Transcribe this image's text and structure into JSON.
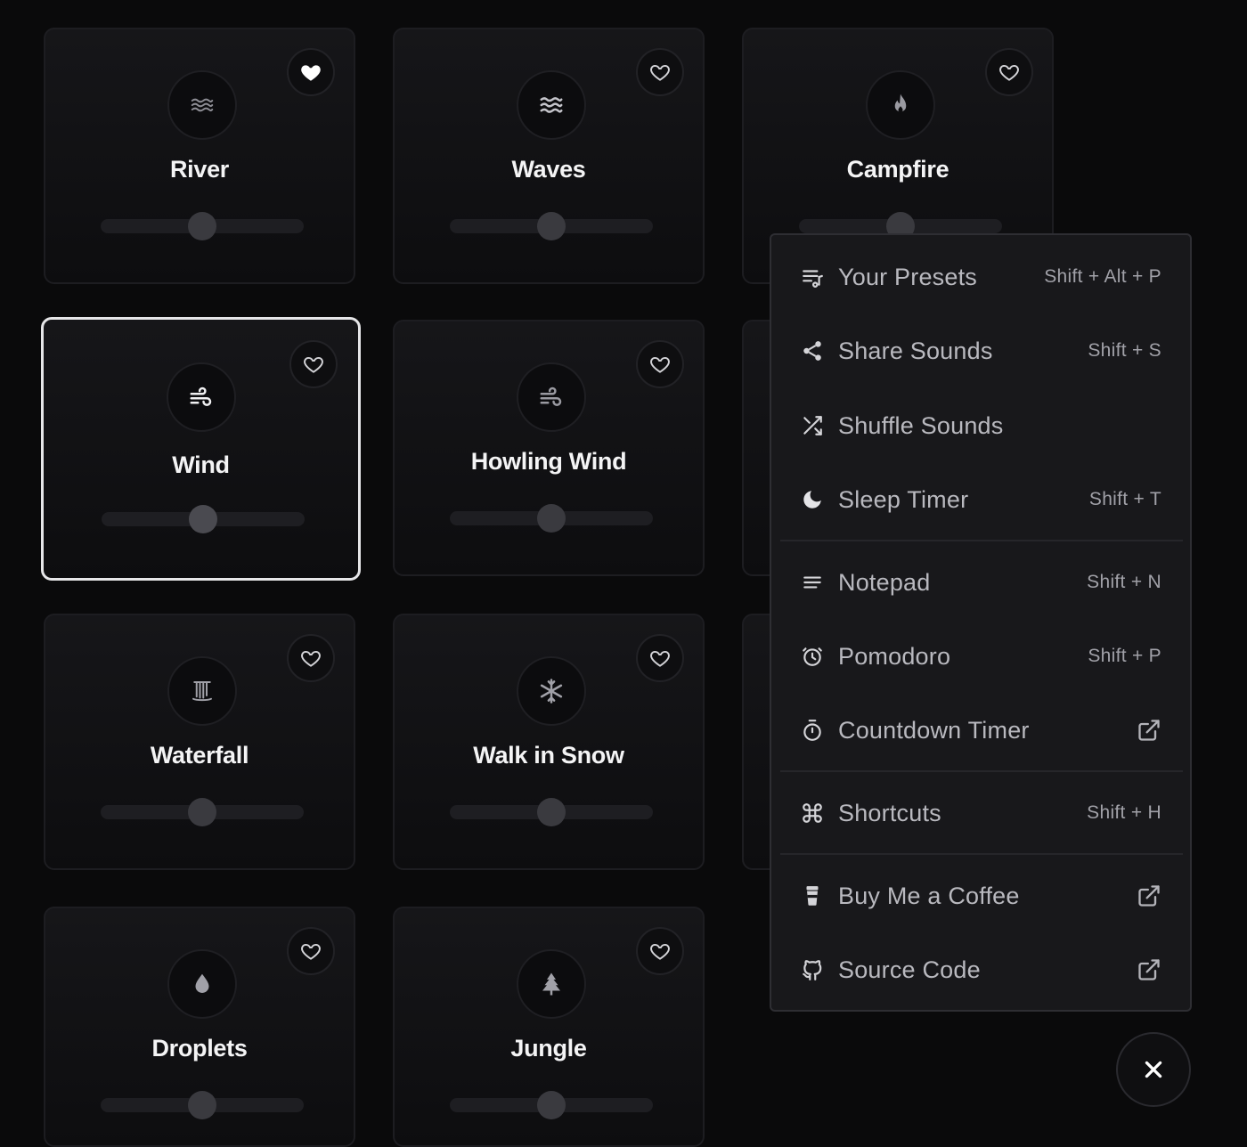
{
  "sounds": [
    {
      "label": "River",
      "icon": "waves-icon",
      "favorite": true
    },
    {
      "label": "Waves",
      "icon": "waves-icon",
      "favorite": false
    },
    {
      "label": "Campfire",
      "icon": "fire-icon",
      "favorite": false
    },
    {
      "label": "Wind",
      "icon": "wind-icon",
      "favorite": false,
      "selected": true
    },
    {
      "label": "Howling Wind",
      "icon": "wind-icon",
      "favorite": false
    },
    {
      "label": "Waterfall",
      "icon": "waterfall-icon",
      "favorite": false
    },
    {
      "label": "Walk in Snow",
      "icon": "snowflake-icon",
      "favorite": false
    },
    {
      "label": "Droplets",
      "icon": "droplet-icon",
      "favorite": false
    },
    {
      "label": "Jungle",
      "icon": "tree-icon",
      "favorite": false
    }
  ],
  "menu": {
    "items": [
      {
        "label": "Your Presets",
        "shortcut": "Shift + Alt + P",
        "icon": "playlist-icon"
      },
      {
        "label": "Share Sounds",
        "shortcut": "Shift + S",
        "icon": "share-icon"
      },
      {
        "label": "Shuffle Sounds",
        "shortcut": "",
        "icon": "shuffle-icon"
      },
      {
        "label": "Sleep Timer",
        "shortcut": "Shift + T",
        "icon": "moon-icon"
      },
      {
        "label": "Notepad",
        "shortcut": "Shift + N",
        "icon": "notepad-icon"
      },
      {
        "label": "Pomodoro",
        "shortcut": "Shift + P",
        "icon": "pomodoro-icon"
      },
      {
        "label": "Countdown Timer",
        "shortcut": "",
        "icon": "stopwatch-icon",
        "external": true
      },
      {
        "label": "Shortcuts",
        "shortcut": "Shift + H",
        "icon": "command-icon"
      },
      {
        "label": "Buy Me a Coffee",
        "shortcut": "",
        "icon": "coffee-icon",
        "external": true
      },
      {
        "label": "Source Code",
        "shortcut": "",
        "icon": "github-icon",
        "external": true
      }
    ]
  },
  "colors": {
    "background": "#0a0a0b",
    "card_border": "#1d1d21",
    "menu_bg": "#18181b",
    "text": "#f4f4f5"
  }
}
